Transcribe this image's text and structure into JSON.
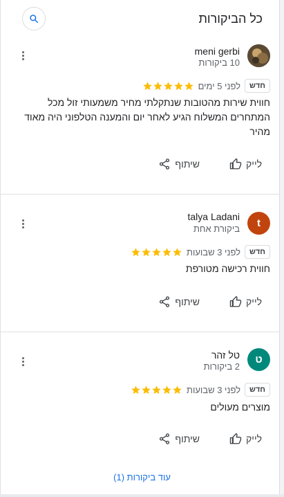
{
  "header": {
    "title": "כל הביקורות"
  },
  "reviews": [
    {
      "name": "meni gerbi",
      "reviews_count": "10 ביקורות",
      "rating": 5,
      "when": "לפני 5 ימים",
      "badge": "חדש",
      "text": "חווית שירות מהטובות שנתקלתי מחיר משמעותי זול מכל המתחרים המשלוח הגיע לאחר יום והמענה הטלפוני היה מאוד מהיר",
      "like_label": "לייק",
      "share_label": "שיתוף"
    },
    {
      "name": "talya Ladani",
      "avatar_letter": "t",
      "avatar_color": "#c1440e",
      "reviews_count": "ביקורת אחת",
      "rating": 5,
      "when": "לפני 3 שבועות",
      "badge": "חדש",
      "text": "חווית רכישה מטורפת",
      "like_label": "לייק",
      "share_label": "שיתוף"
    },
    {
      "name": "טל זהר",
      "avatar_letter": "ט",
      "avatar_color": "#00897b",
      "reviews_count": "2 ביקורות",
      "rating": 5,
      "when": "לפני 3 שבועות",
      "badge": "חדש",
      "text": "מוצרים מעולים",
      "like_label": "לייק",
      "share_label": "שיתוף"
    }
  ],
  "footer": {
    "more_reviews": "עוד ביקורות (1)"
  },
  "colors": {
    "star": "#fbbc04",
    "link": "#1a73e8"
  }
}
